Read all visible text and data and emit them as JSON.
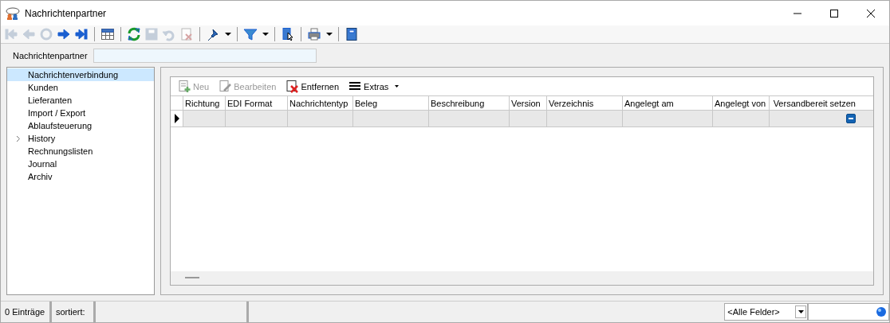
{
  "window": {
    "title": "Nachrichtenpartner"
  },
  "toolbar": [
    {
      "kind": "first",
      "disabled": true
    },
    {
      "kind": "prev",
      "disabled": true
    },
    {
      "kind": "goto",
      "disabled": true
    },
    {
      "kind": "next",
      "disabled": false
    },
    {
      "kind": "last",
      "disabled": false
    },
    {
      "kind": "sep"
    },
    {
      "kind": "table",
      "disabled": false
    },
    {
      "kind": "sep"
    },
    {
      "kind": "refresh",
      "disabled": false
    },
    {
      "kind": "save",
      "disabled": true
    },
    {
      "kind": "undo",
      "disabled": true
    },
    {
      "kind": "delete",
      "disabled": true
    },
    {
      "kind": "sep"
    },
    {
      "kind": "pin",
      "disabled": false,
      "dropdown": true
    },
    {
      "kind": "sep"
    },
    {
      "kind": "filter",
      "disabled": false,
      "dropdown": true
    },
    {
      "kind": "sep"
    },
    {
      "kind": "pointer",
      "disabled": false
    },
    {
      "kind": "sep"
    },
    {
      "kind": "print",
      "disabled": false,
      "dropdown": true
    },
    {
      "kind": "sep"
    },
    {
      "kind": "book",
      "disabled": false
    }
  ],
  "field": {
    "label": "Nachrichtenpartner"
  },
  "sidebar": {
    "items": [
      {
        "label": "Nachrichtenverbindung",
        "selected": true
      },
      {
        "label": "Kunden",
        "selected": false
      },
      {
        "label": "Lieferanten",
        "selected": false
      },
      {
        "label": "Import / Export",
        "selected": false
      },
      {
        "label": "Ablaufsteuerung",
        "selected": false
      },
      {
        "label": "History",
        "selected": false,
        "expanded": false
      },
      {
        "label": "Rechnungslisten",
        "selected": false
      },
      {
        "label": "Journal",
        "selected": false
      },
      {
        "label": "Archiv",
        "selected": false
      }
    ]
  },
  "grid_toolbar": [
    {
      "kind": "new",
      "label": "Neu",
      "disabled": true
    },
    {
      "kind": "edit",
      "label": "Bearbeiten",
      "disabled": true
    },
    {
      "kind": "remove",
      "label": "Entfernen",
      "disabled": false
    },
    {
      "kind": "extras",
      "label": "Extras",
      "disabled": false
    }
  ],
  "table": {
    "columns": [
      "Richtung",
      "EDI Format",
      "Nachrichtentyp",
      "Beleg",
      "Beschreibung",
      "Version",
      "Verzeichnis",
      "Angelegt am",
      "Angelegt von",
      "Versandbereit setzen"
    ],
    "rows": [
      {
        "current": true,
        "indeterminate": true
      }
    ]
  },
  "status_bar": {
    "count": "0 Einträge",
    "sort": "sortiert:",
    "field_choice": "<Alle Felder>"
  }
}
